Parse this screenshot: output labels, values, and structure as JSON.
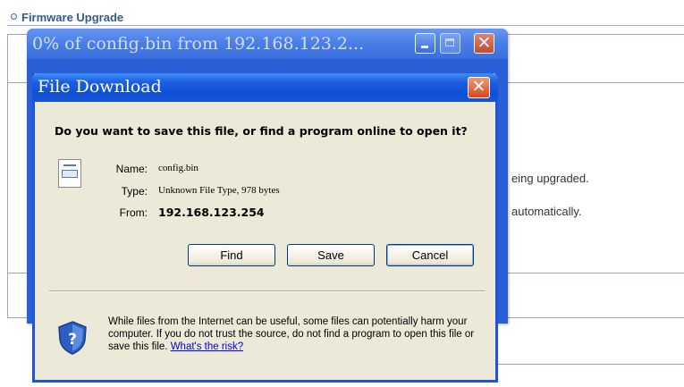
{
  "background": {
    "section_title": "Firmware Upgrade",
    "text_line1": "eing upgraded.",
    "text_line2": "automatically."
  },
  "progress_window": {
    "title": "0% of config.bin from 192.168.123.2..."
  },
  "dialog": {
    "title": "File Download",
    "question": "Do you want to save this file, or find a program online to open it?",
    "fields": {
      "name_label": "Name:",
      "name_value": "config.bin",
      "type_label": "Type:",
      "type_value": "Unknown File Type, 978 bytes",
      "from_label": "From:",
      "from_value": "192.168.123.254"
    },
    "buttons": {
      "find": "Find",
      "save": "Save",
      "cancel": "Cancel"
    },
    "warning": "While files from the Internet can be useful, some files can potentially harm your computer. If you do not trust the source, do not find a program to open this file or save this file.",
    "risk_link": "What's the risk?"
  },
  "colors": {
    "titlebar_blue": "#0d4fd8",
    "dialog_face": "#ece9d8",
    "close_red": "#d8461e",
    "link_blue": "#0000ee",
    "section_title": "#2f5b94"
  },
  "icons": [
    "file-icon",
    "shield-question-icon",
    "close-icon",
    "minimize-icon",
    "maximize-icon"
  ]
}
